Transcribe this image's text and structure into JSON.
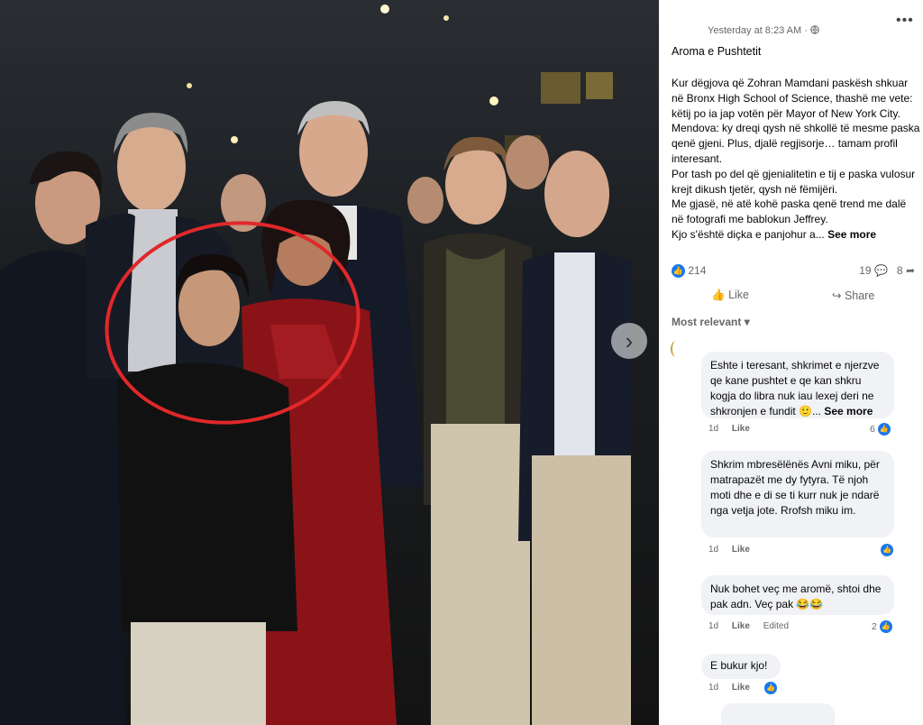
{
  "post": {
    "timestamp": "Yesterday at 8:23 AM · ",
    "title": "Aroma e Pushtetit",
    "paragraphs": [
      "Kur dëgjova që Zohran Mamdani paskësh shkuar në Bronx High School of Science, thashë me vete: këtij po ia jap votën për Mayor of New York City.",
      "Mendova: ky dreqi qysh në shkollë të mesme paska qenë gjeni. Plus, djalë regjisorje… tamam profil interesant.",
      "Por tash po del që gjenialitetin e tij e paska vulosur krejt dikush tjetër, qysh në fëmijëri.",
      "Me gjasë, në atë kohë paska qenë trend me dalë në fotografi me bablokun Jeffrey."
    ],
    "last_line": "Kjo s'është diçka e panjohur a...",
    "see_more": "See more",
    "reaction_count": "214",
    "comment_count": "19",
    "share_count": "8",
    "like_label": "Like",
    "share_label": "Share",
    "sort_label": "Most relevant"
  },
  "comments": [
    {
      "text": "Eshte i teresant, shkrimet e njerzve qe kane pushtet e qe kan shkru kogja do libra nuk iau lexej deri ne shkronjen e fundit 🙂...",
      "see_more": "See more",
      "time": "1d",
      "like": "Like",
      "count": "6"
    },
    {
      "text": "Shkrim mbresëlënës Avni miku, për matrapazët me dy fytyra. Të njoh moti dhe e di se ti kurr nuk je ndarë nga vetja jote. Rrofsh miku im.",
      "time": "1d",
      "like": "Like"
    },
    {
      "text": "Nuk bohet veç me aromë, shtoi dhe pak adn. Veç pak 😂😂",
      "time": "1d",
      "like": "Like",
      "edited": "Edited",
      "count": "2"
    },
    {
      "text": "E bukur kjo!",
      "time": "1d",
      "like": "Like"
    }
  ],
  "icons": {
    "globe": "globe-icon",
    "more": "more-options-icon",
    "next": "chevron-right-icon",
    "like": "thumbs-up-icon",
    "share": "share-icon"
  },
  "colors": {
    "accent": "#1877f2",
    "circle": "#e0282a"
  }
}
